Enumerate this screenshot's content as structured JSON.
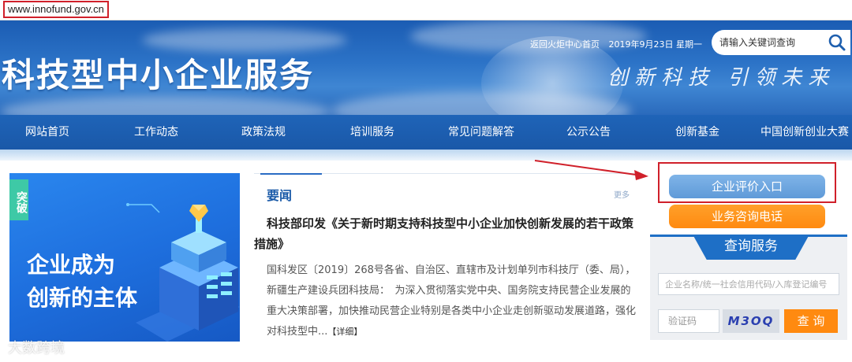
{
  "browser": {
    "url": "www.innofund.gov.cn"
  },
  "header": {
    "site_title": "科技型中小企业服务",
    "slogan": "创新科技 引领未来",
    "top_links": {
      "home_link": "返回火炬中心首页",
      "date": "2019年9月23日 星期一"
    },
    "search_placeholder": "请输入关键词查询"
  },
  "nav": {
    "items": [
      {
        "label": "网站首页"
      },
      {
        "label": "工作动态"
      },
      {
        "label": "政策法规"
      },
      {
        "label": "培训服务"
      },
      {
        "label": "常见问题解答"
      },
      {
        "label": "公示公告"
      },
      {
        "label": "创新基金"
      },
      {
        "label": "中国创新创业大赛"
      }
    ]
  },
  "promo": {
    "tag": "突破",
    "line1": "企业成为",
    "line2": "创新的主体"
  },
  "news": {
    "heading": "要闻",
    "more": "更多",
    "title": "科技部印发《关于新时期支持科技型中小企业加快创新发展的若干政策措施》",
    "body": "国科发区〔2019〕268号各省、自治区、直辖市及计划单列市科技厅（委、局），新疆生产建设兵团科技局：　为深入贯彻落实党中央、国务院支持民营企业发展的重大决策部署，加快推动民营企业特别是各类中小企业走创新驱动发展道路，强化对科技型中...",
    "detail": "【详细】"
  },
  "sidebar": {
    "eval_button": "企业评价入口",
    "phone_button": "业务咨询电话",
    "query": {
      "title": "查询服务",
      "company_placeholder": "企业名称/统一社会信用代码/入库登记编号",
      "code_placeholder": "验证码",
      "captcha": "M3OQ",
      "submit": "查 询"
    }
  },
  "watermark": "大数跨境",
  "colors": {
    "brand_blue": "#1e6fc6",
    "orange": "#ff8a10",
    "annotation_red": "#d0202a"
  }
}
